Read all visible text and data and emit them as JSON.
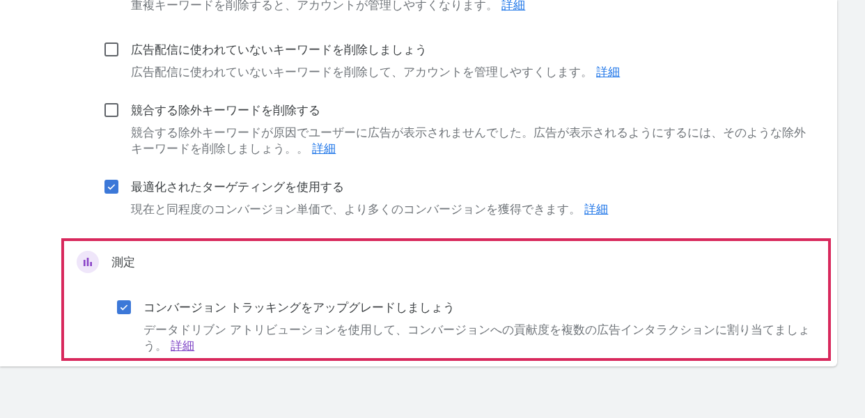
{
  "top_note": {
    "text": "重複キーワードを削除すると、アカウントが管理しやすくなります。",
    "link": "詳細",
    "visited": false
  },
  "items": [
    {
      "title": "広告配信に使われていないキーワードを削除しましょう",
      "checked": false,
      "description": "広告配信に使われていないキーワードを削除して、アカウントを管理しやすくします。",
      "link": "詳細",
      "visited": false
    },
    {
      "title": "競合する除外キーワードを削除する",
      "checked": false,
      "description": "競合する除外キーワードが原因でユーザーに広告が表示されませんでした。広告が表示されるようにするには、そのような除外キーワードを削除しましょう。。",
      "link": "詳細",
      "visited": false
    },
    {
      "title": "最適化されたターゲティングを使用する",
      "checked": true,
      "description": "現在と同程度のコンバージョン単価で、より多くのコンバージョンを獲得できます。",
      "link": "詳細",
      "visited": false
    }
  ],
  "section": {
    "title": "測定",
    "highlighted": true,
    "items": [
      {
        "title": "コンバージョン トラッキングをアップグレードしましょう",
        "checked": true,
        "description": "データドリブン アトリビューションを使用して、コンバージョンへの貢献度を複数の広告インタラクションに割り当てましょう。",
        "link": "詳細",
        "visited": true
      }
    ]
  }
}
